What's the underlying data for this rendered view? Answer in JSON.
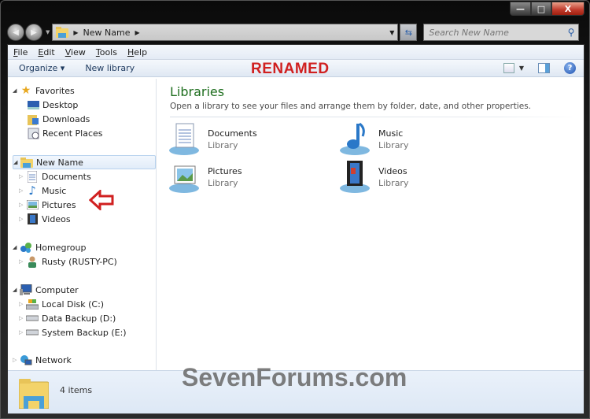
{
  "window": {
    "caption_buttons": {
      "minimize": "—",
      "maximize": "□",
      "close": "X"
    }
  },
  "navbar": {
    "back_icon": "back-arrow-icon",
    "forward_icon": "forward-arrow-icon",
    "breadcrumb": [
      "New Name"
    ],
    "search_placeholder": "Search New Name"
  },
  "menubar": {
    "items": [
      {
        "label": "File",
        "mnemonic": "F",
        "rest": "ile"
      },
      {
        "label": "Edit",
        "mnemonic": "E",
        "rest": "dit"
      },
      {
        "label": "View",
        "mnemonic": "V",
        "rest": "iew"
      },
      {
        "label": "Tools",
        "mnemonic": "T",
        "rest": "ools"
      },
      {
        "label": "Help",
        "mnemonic": "H",
        "rest": "elp"
      }
    ]
  },
  "commandbar": {
    "organize": "Organize ▾",
    "new_library": "New library",
    "annotation": "RENAMED"
  },
  "sidebar": {
    "favorites": {
      "label": "Favorites",
      "children": [
        "Desktop",
        "Downloads",
        "Recent Places"
      ]
    },
    "libraries": {
      "label": "New Name",
      "children": [
        "Documents",
        "Music",
        "Pictures",
        "Videos"
      ]
    },
    "homegroup": {
      "label": "Homegroup",
      "children": [
        "Rusty (RUSTY-PC)"
      ]
    },
    "computer": {
      "label": "Computer",
      "children": [
        "Local Disk (C:)",
        "Data Backup (D:)",
        "System Backup (E:)"
      ]
    },
    "network": {
      "label": "Network"
    }
  },
  "content": {
    "title": "Libraries",
    "description": "Open a library to see your files and arrange them by folder, date, and other properties.",
    "items": [
      {
        "name": "Documents",
        "type": "Library"
      },
      {
        "name": "Music",
        "type": "Library"
      },
      {
        "name": "Pictures",
        "type": "Library"
      },
      {
        "name": "Videos",
        "type": "Library"
      }
    ]
  },
  "status": {
    "count": "4 items"
  },
  "watermark": "SevenForums.com"
}
